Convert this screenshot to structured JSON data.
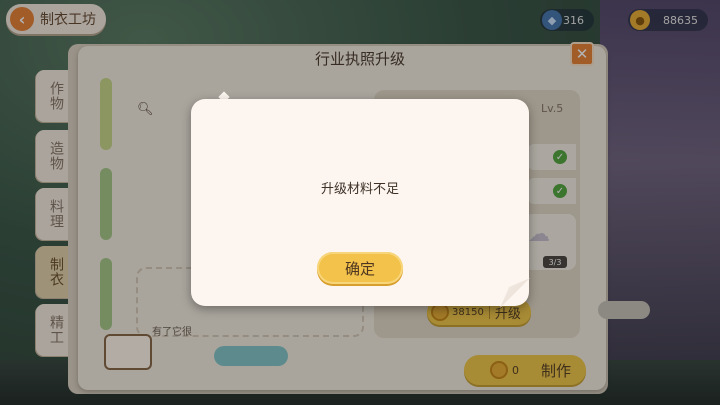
{
  "header": {
    "back_label": "制衣工坊",
    "resources": [
      {
        "name": "energy",
        "icon": "gem-icon",
        "value": "316"
      },
      {
        "name": "coins",
        "icon": "coin-icon",
        "value": "88635"
      }
    ]
  },
  "panel": {
    "title": "行业执照升级",
    "close_symbol": "✕",
    "tabs": [
      {
        "label": "作物",
        "active": false
      },
      {
        "label": "造物",
        "active": false
      },
      {
        "label": "料理",
        "active": false
      },
      {
        "label": "制衣",
        "active": true
      },
      {
        "label": "精工",
        "active": false
      }
    ],
    "description": "有了它很",
    "level": "Lv.5",
    "material_count": "3/3",
    "upgrade": {
      "cost": "38150",
      "label": "升级"
    },
    "craft": {
      "cost": "0",
      "label": "制作"
    }
  },
  "dialog": {
    "message": "升级材料不足",
    "confirm_label": "确定"
  },
  "colors": {
    "accent_orange": "#e8843a",
    "button_yellow": "#f1c84c",
    "check_green": "#56a842",
    "dialog_bg": "#fdf6f0"
  }
}
